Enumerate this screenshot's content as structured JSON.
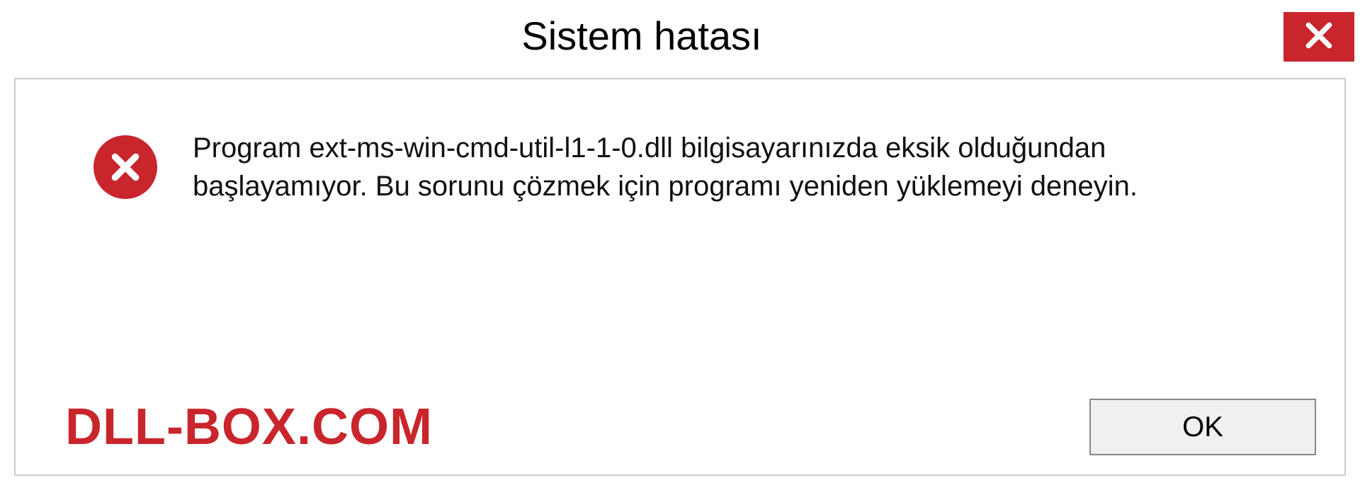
{
  "titlebar": {
    "title": "Sistem hatası"
  },
  "content": {
    "message": "Program ext-ms-win-cmd-util-l1-1-0.dll bilgisayarınızda eksik olduğundan başlayamıyor. Bu sorunu çözmek için programı yeniden yüklemeyi deneyin."
  },
  "footer": {
    "brand": "DLL-BOX.COM",
    "ok_label": "OK"
  },
  "colors": {
    "accent": "#c9252c"
  }
}
